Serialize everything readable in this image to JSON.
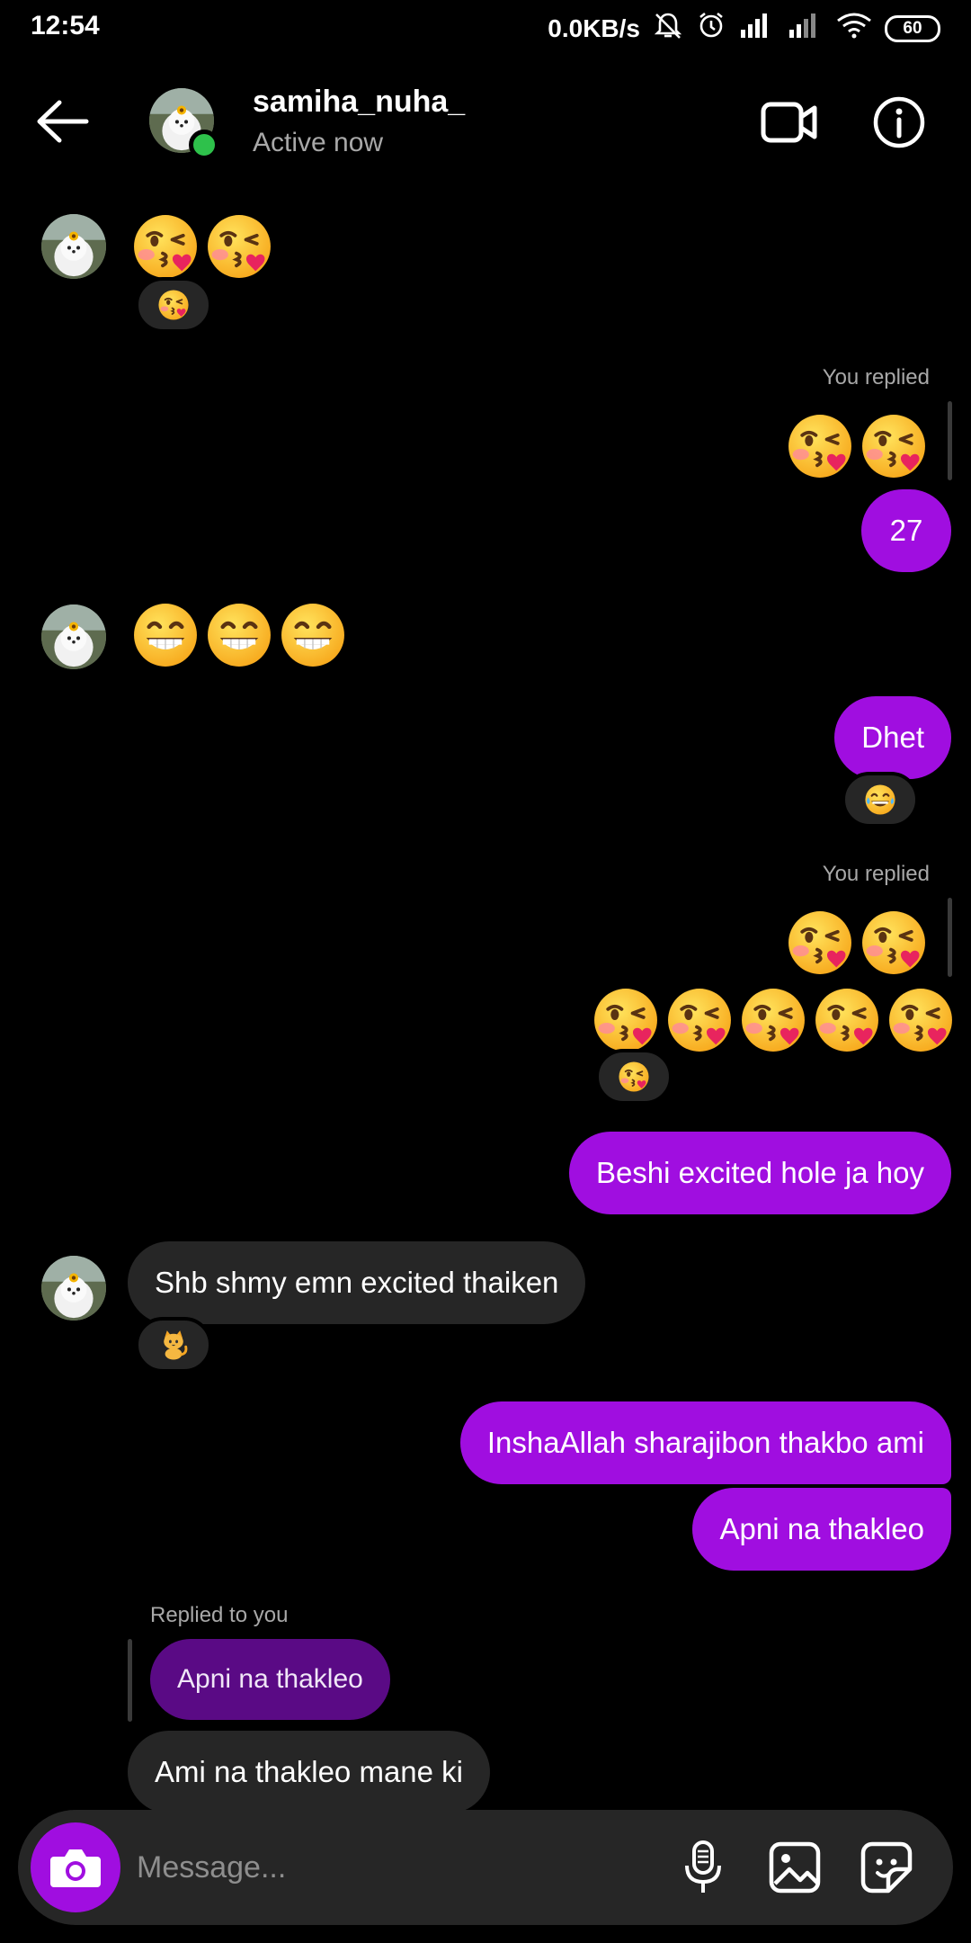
{
  "status_bar": {
    "time": "12:54",
    "speed": "0.0KB/s",
    "battery": "60"
  },
  "header": {
    "username": "samiha_nuha_",
    "status": "Active now"
  },
  "messages": {
    "you_replied_1": "You replied",
    "out_27": "27",
    "out_dhet": "Dhet",
    "you_replied_2": "You replied",
    "out_beshi": "Beshi excited hole ja hoy",
    "in_shb": "Shb shmy emn excited thaiken",
    "out_inshaallah": "InshaAllah sharajibon thakbo ami",
    "out_apni": "Apni na thakleo",
    "replied_to_you": "Replied to you",
    "quoted_apni": "Apni na thakleo",
    "in_ami": "Ami na thakleo mane ki"
  },
  "reactions": {
    "r1": "kiss-emoji",
    "r2": "laugh-emoji",
    "r3": "kiss-emoji",
    "r4": "cat-emoji"
  },
  "composer": {
    "placeholder": "Message..."
  },
  "colors": {
    "accent": "#a00ee0",
    "incoming_bubble": "#262626",
    "quoted_bubble": "#5a0a85",
    "online": "#2ec14b"
  }
}
